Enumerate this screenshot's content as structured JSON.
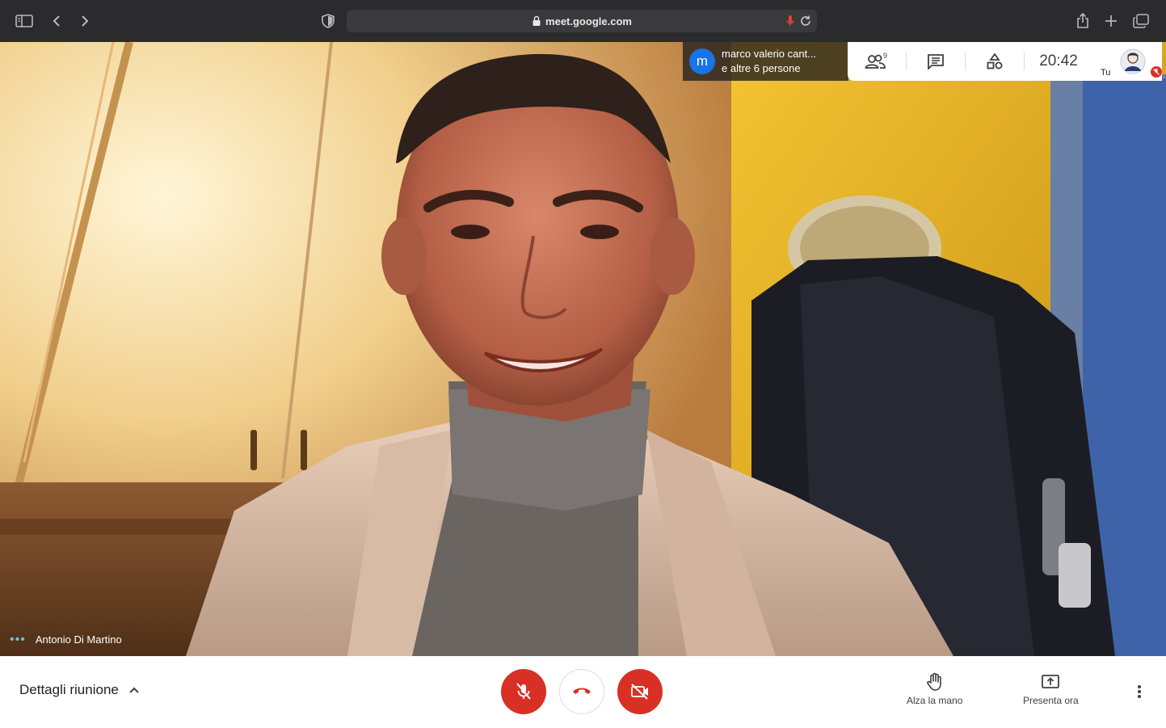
{
  "browser": {
    "url": "meet.google.com"
  },
  "video": {
    "speaker_name": "Antonio Di Martino"
  },
  "participants": {
    "avatar_letter": "m",
    "line1": "marco valerio cant...",
    "line2": "e altre 6 persone",
    "count": "9"
  },
  "topbar": {
    "clock": "20:42",
    "self_label": "Tu"
  },
  "bottom": {
    "details_label": "Dettagli riunione",
    "raise_hand_label": "Alza la mano",
    "present_label": "Presenta ora"
  },
  "colors": {
    "red": "#d93025",
    "accent": "#1a73e8"
  }
}
